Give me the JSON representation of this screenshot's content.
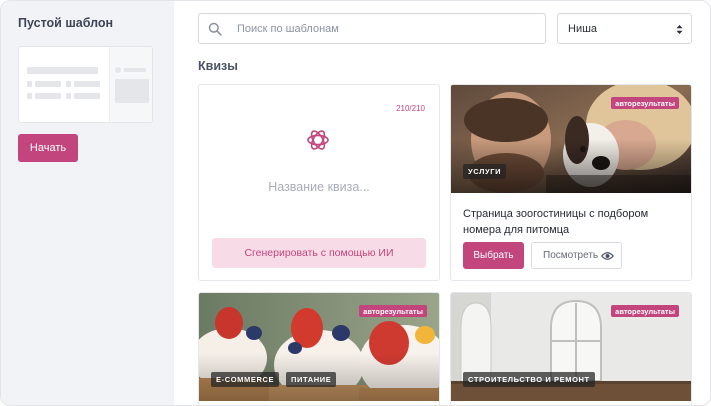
{
  "sidebar": {
    "title": "Пустой шаблон",
    "start_label": "Начать"
  },
  "search": {
    "placeholder": "Поиск по шаблонам",
    "icon": "search-icon"
  },
  "filter": {
    "niche_label": "Ниша"
  },
  "section": {
    "heading": "Квизы"
  },
  "generator": {
    "counter": "210/210",
    "placeholder": "Название квиза...",
    "button_label": "Сгенерировать с помощью ИИ",
    "icon": "openai-icon"
  },
  "templates": [
    {
      "badge": "авторезультаты",
      "tags": [
        "УСЛУГИ"
      ],
      "title": "Страница зоогостиницы с подбором номера для питомца",
      "choose_label": "Выбрать",
      "view_label": "Посмотреть"
    },
    {
      "badge": "авторезультаты",
      "tags": [
        "E-COMMERCE",
        "ПИТАНИЕ"
      ]
    },
    {
      "badge": "авторезультаты",
      "tags": [
        "СТРОИТЕЛЬСТВО И РЕМОНТ"
      ]
    }
  ],
  "colors": {
    "accent": "#c2457d",
    "accent_light": "#f7dbe7",
    "sidebar_bg": "#f2f3f6"
  }
}
